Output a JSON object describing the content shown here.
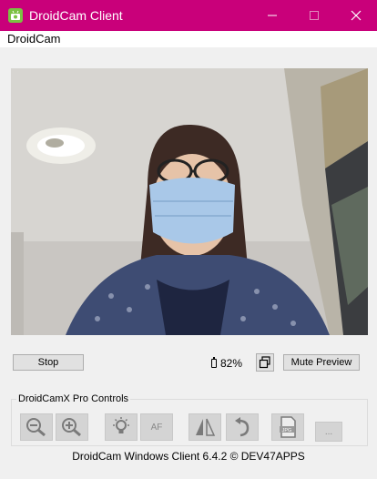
{
  "window": {
    "title": "DroidCam Client"
  },
  "menu": {
    "items": [
      "DroidCam"
    ]
  },
  "controls": {
    "stop_label": "Stop",
    "battery": "82%",
    "mute_label": "Mute Preview",
    "pro_group_label": "DroidCamX Pro Controls",
    "af_label": "AF",
    "more_label": "...",
    "jpg_label": "JPG"
  },
  "footer": {
    "text": "DroidCam Windows Client 6.4.2 © DEV47APPS"
  },
  "colors": {
    "titlebar": "#c9007a",
    "window_bg": "#f0f0f0"
  }
}
